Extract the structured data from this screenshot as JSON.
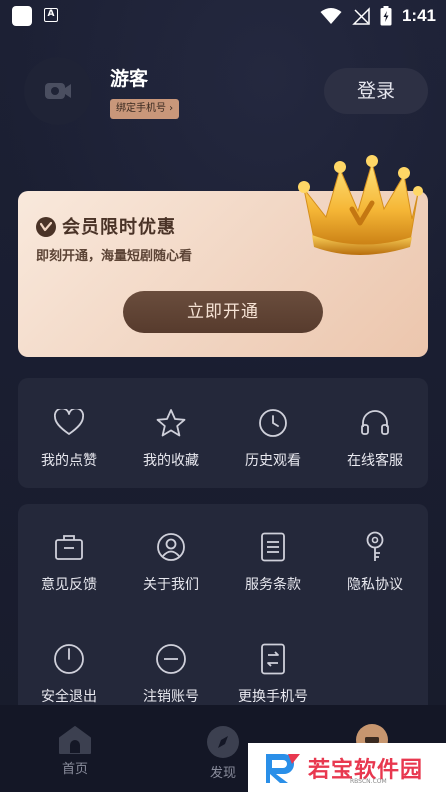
{
  "status_bar": {
    "time": "1:41"
  },
  "profile": {
    "username": "游客",
    "bind_phone": "绑定手机号",
    "login": "登录"
  },
  "vip": {
    "title": "会员限时优惠",
    "subtitle": "即刻开通，海量短剧随心看",
    "button": "立即开通",
    "badge_letter": "V"
  },
  "quick_actions": [
    {
      "label": "我的点赞",
      "icon": "heart-icon"
    },
    {
      "label": "我的收藏",
      "icon": "star-icon"
    },
    {
      "label": "历史观看",
      "icon": "clock-icon"
    },
    {
      "label": "在线客服",
      "icon": "headset-icon"
    }
  ],
  "settings": [
    {
      "label": "意见反馈",
      "icon": "feedback-bag-icon"
    },
    {
      "label": "关于我们",
      "icon": "user-circle-icon"
    },
    {
      "label": "服务条款",
      "icon": "document-icon"
    },
    {
      "label": "隐私协议",
      "icon": "key-icon"
    },
    {
      "label": "安全退出",
      "icon": "power-icon"
    },
    {
      "label": "注销账号",
      "icon": "minus-circle-icon"
    },
    {
      "label": "更换手机号",
      "icon": "phone-swap-icon"
    }
  ],
  "bottom_nav": [
    {
      "label": "首页",
      "icon": "home-icon"
    },
    {
      "label": "发现",
      "icon": "compass-icon"
    },
    {
      "label": "",
      "icon": "profile-tab-icon"
    }
  ],
  "watermark": {
    "text": "若宝软件园",
    "small": "RBSCN.COM"
  },
  "colors": {
    "background": "#1a1e31",
    "panel": "#24283a",
    "vip_button": "#5f4334",
    "accent_gold": "#f2b945"
  }
}
